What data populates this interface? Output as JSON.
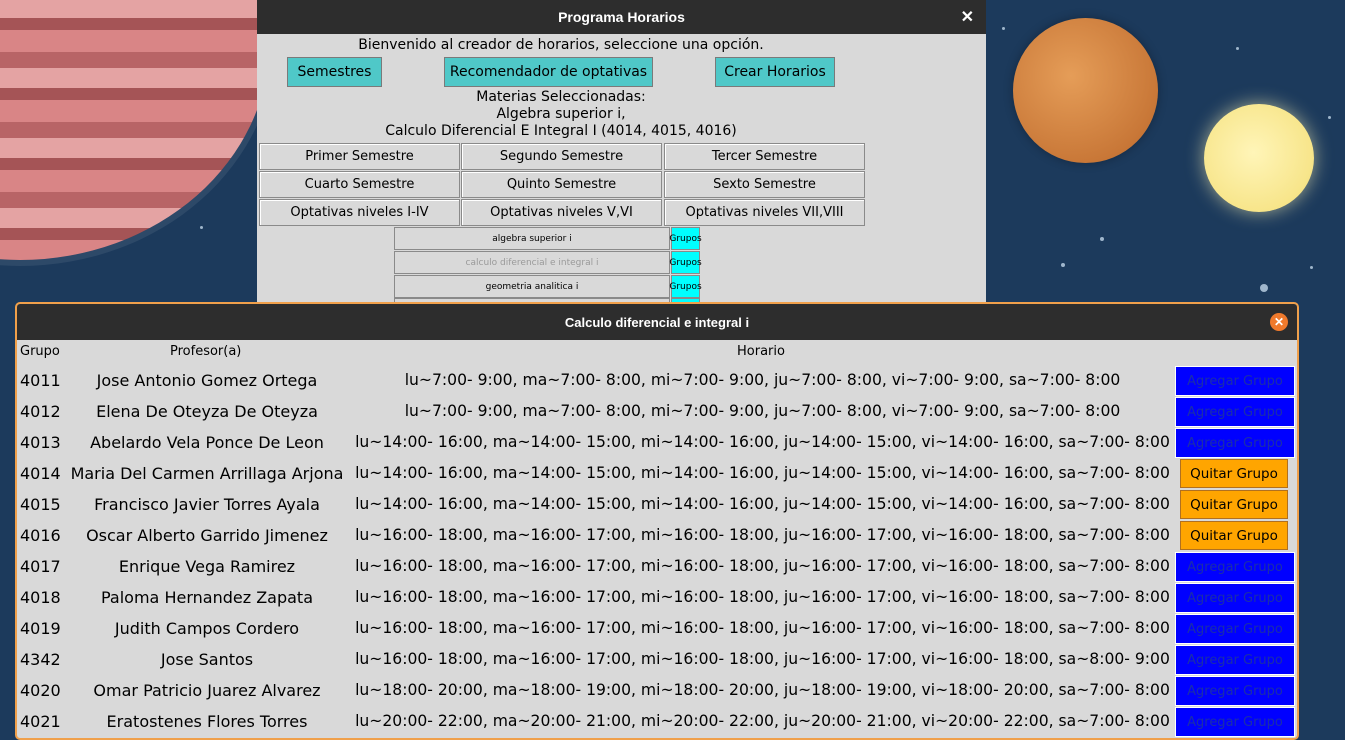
{
  "main_window": {
    "title": "Programa Horarios",
    "welcome": "Bienvenido al creador de horarios, seleccione una opción.",
    "top_buttons": [
      "Semestres",
      "Recomendador de optativas",
      "Crear Horarios"
    ],
    "selected_title": "Materias Seleccionadas:",
    "selected_items": [
      "Algebra superior i,",
      "Calculo Diferencial E Integral I (4014, 4015, 4016)"
    ],
    "semesters": [
      "Primer Semestre",
      "Segundo Semestre",
      "Tercer Semestre",
      "Cuarto Semestre",
      "Quinto Semestre",
      "Sexto Semestre",
      "Optativas niveles I-IV",
      "Optativas niveles V,VI",
      "Optativas niveles VII,VIII"
    ],
    "courses": [
      "algebra superior i",
      "calculo diferencial e integral i",
      "geometria analitica i"
    ],
    "groups_label": "Grupos"
  },
  "dialog": {
    "title": "Calculo diferencial e integral i",
    "headers": {
      "grupo": "Grupo",
      "profesor": "Profesor(a)",
      "horario": "Horario"
    },
    "rows": [
      {
        "grupo": "4011",
        "profesor": "Jose Antonio Gomez Ortega",
        "horario": "lu~7:00- 9:00, ma~7:00- 8:00, mi~7:00- 9:00, ju~7:00- 8:00, vi~7:00- 9:00, sa~7:00- 8:00",
        "action": "Agregar Grupo"
      },
      {
        "grupo": "4012",
        "profesor": "Elena De Oteyza De Oteyza",
        "horario": "lu~7:00- 9:00, ma~7:00- 8:00, mi~7:00- 9:00, ju~7:00- 8:00, vi~7:00- 9:00, sa~7:00- 8:00",
        "action": "Agregar Grupo"
      },
      {
        "grupo": "4013",
        "profesor": "Abelardo Vela Ponce De Leon",
        "horario": "lu~14:00- 16:00, ma~14:00- 15:00, mi~14:00- 16:00, ju~14:00- 15:00, vi~14:00- 16:00, sa~7:00- 8:00",
        "action": "Agregar Grupo"
      },
      {
        "grupo": "4014",
        "profesor": "Maria Del Carmen Arrillaga Arjona",
        "horario": "lu~14:00- 16:00, ma~14:00- 15:00, mi~14:00- 16:00, ju~14:00- 15:00, vi~14:00- 16:00, sa~7:00- 8:00",
        "action": "Quitar Grupo"
      },
      {
        "grupo": "4015",
        "profesor": "Francisco Javier Torres Ayala",
        "horario": "lu~14:00- 16:00, ma~14:00- 15:00, mi~14:00- 16:00, ju~14:00- 15:00, vi~14:00- 16:00, sa~7:00- 8:00",
        "action": "Quitar Grupo"
      },
      {
        "grupo": "4016",
        "profesor": "Oscar Alberto Garrido Jimenez",
        "horario": "lu~16:00- 18:00, ma~16:00- 17:00, mi~16:00- 18:00, ju~16:00- 17:00, vi~16:00- 18:00, sa~7:00- 8:00",
        "action": "Quitar Grupo"
      },
      {
        "grupo": "4017",
        "profesor": "Enrique Vega Ramirez",
        "horario": "lu~16:00- 18:00, ma~16:00- 17:00, mi~16:00- 18:00, ju~16:00- 17:00, vi~16:00- 18:00, sa~7:00- 8:00",
        "action": "Agregar Grupo"
      },
      {
        "grupo": "4018",
        "profesor": "Paloma Hernandez Zapata",
        "horario": "lu~16:00- 18:00, ma~16:00- 17:00, mi~16:00- 18:00, ju~16:00- 17:00, vi~16:00- 18:00, sa~7:00- 8:00",
        "action": "Agregar Grupo"
      },
      {
        "grupo": "4019",
        "profesor": "Judith Campos Cordero",
        "horario": "lu~16:00- 18:00, ma~16:00- 17:00, mi~16:00- 18:00, ju~16:00- 17:00, vi~16:00- 18:00, sa~7:00- 8:00",
        "action": "Agregar Grupo"
      },
      {
        "grupo": "4342",
        "profesor": "Jose Santos",
        "horario": "lu~16:00- 18:00, ma~16:00- 17:00, mi~16:00- 18:00, ju~16:00- 17:00, vi~16:00- 18:00, sa~8:00- 9:00",
        "action": "Agregar Grupo"
      },
      {
        "grupo": "4020",
        "profesor": "Omar Patricio Juarez Alvarez",
        "horario": "lu~18:00- 20:00, ma~18:00- 19:00, mi~18:00- 20:00, ju~18:00- 19:00, vi~18:00- 20:00, sa~7:00- 8:00",
        "action": "Agregar Grupo"
      },
      {
        "grupo": "4021",
        "profesor": "Eratostenes Flores Torres",
        "horario": "lu~20:00- 22:00, ma~20:00- 21:00, mi~20:00- 22:00, ju~20:00- 21:00, vi~20:00- 22:00, sa~7:00- 8:00",
        "action": "Agregar Grupo"
      }
    ]
  },
  "colors": {
    "add": "#0000ff",
    "remove": "#ffa500",
    "accent": "#4fc8c8",
    "groups": "#00ffff"
  }
}
